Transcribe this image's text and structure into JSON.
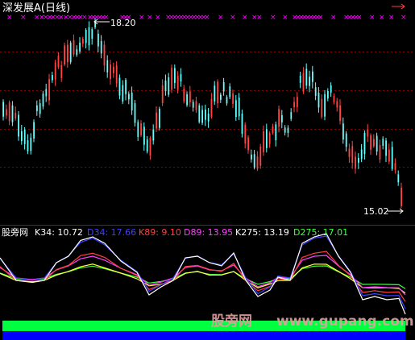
{
  "header": {
    "title": "深发展A(日线)",
    "marker": "×"
  },
  "price_panel": {
    "high_label": "18.20",
    "low_label": "15.02",
    "marker_color": "#ff00ff",
    "up_color": "#ff4444",
    "down_color": "#66ffff"
  },
  "indicator_panel": {
    "name": "股旁网",
    "values": [
      {
        "label": "K34: 10.72",
        "color": "#ffffff"
      },
      {
        "label": "D34: 17.66",
        "color": "#4040ff"
      },
      {
        "label": "K89: 9.10",
        "color": "#ff4040"
      },
      {
        "label": "D89: 13.95",
        "color": "#ff40ff"
      },
      {
        "label": "K275: 13.19",
        "color": "#ffffff"
      },
      {
        "label": "D275: 17.01",
        "color": "#40ff40"
      }
    ]
  },
  "bottom_bars": {
    "green": "#00ff40",
    "blue": "#0000ff"
  },
  "watermark": {
    "cn": "股旁网",
    "en": "www.gupang.com"
  }
}
